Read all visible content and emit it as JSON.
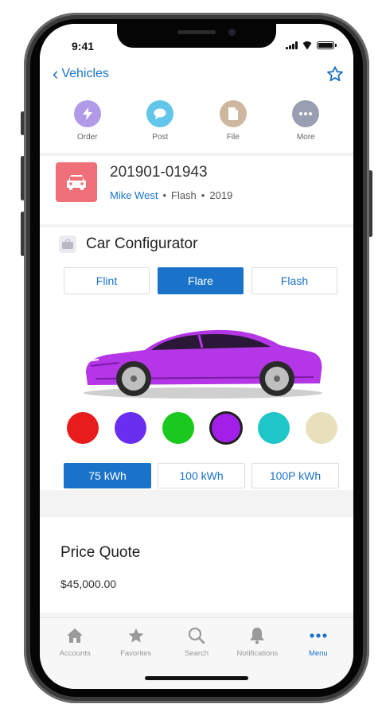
{
  "status_bar": {
    "time": "9:41"
  },
  "nav": {
    "back_label": "Vehicles"
  },
  "actions": [
    {
      "label": "Order",
      "color": "#b19be8",
      "icon": "lightning-icon"
    },
    {
      "label": "Post",
      "color": "#62c6ea",
      "icon": "chat-bubble-icon"
    },
    {
      "label": "File",
      "color": "#cdb89f",
      "icon": "document-icon"
    },
    {
      "label": "More",
      "color": "#9a9eb2",
      "icon": "ellipsis-icon"
    }
  ],
  "record": {
    "number": "201901-01943",
    "owner": "Mike West",
    "separator": "•",
    "model": "Flash",
    "year": "2019"
  },
  "configurator": {
    "title": "Car Configurator",
    "trims": [
      "Flint",
      "Flare",
      "Flash"
    ],
    "selected_trim": "Flare",
    "colors": [
      "#e81c1c",
      "#6a2ef0",
      "#1ac91e",
      "#a21fe8",
      "#1ec6c9",
      "#e8e0bd"
    ],
    "selected_color": "#a21fe8",
    "batteries": [
      "75 kWh",
      "100 kWh",
      "100P kWh"
    ],
    "selected_battery": "75 kWh"
  },
  "quote": {
    "title": "Price Quote",
    "amount": "$45,000.00"
  },
  "tabs": [
    {
      "label": "Accounts",
      "icon": "home-icon"
    },
    {
      "label": "Favorites",
      "icon": "star-icon"
    },
    {
      "label": "Search",
      "icon": "search-icon"
    },
    {
      "label": "Notifications",
      "icon": "bell-icon"
    },
    {
      "label": "Menu",
      "icon": "menu-icon"
    }
  ],
  "active_tab": "Menu",
  "accent_color": "#1a73c9"
}
